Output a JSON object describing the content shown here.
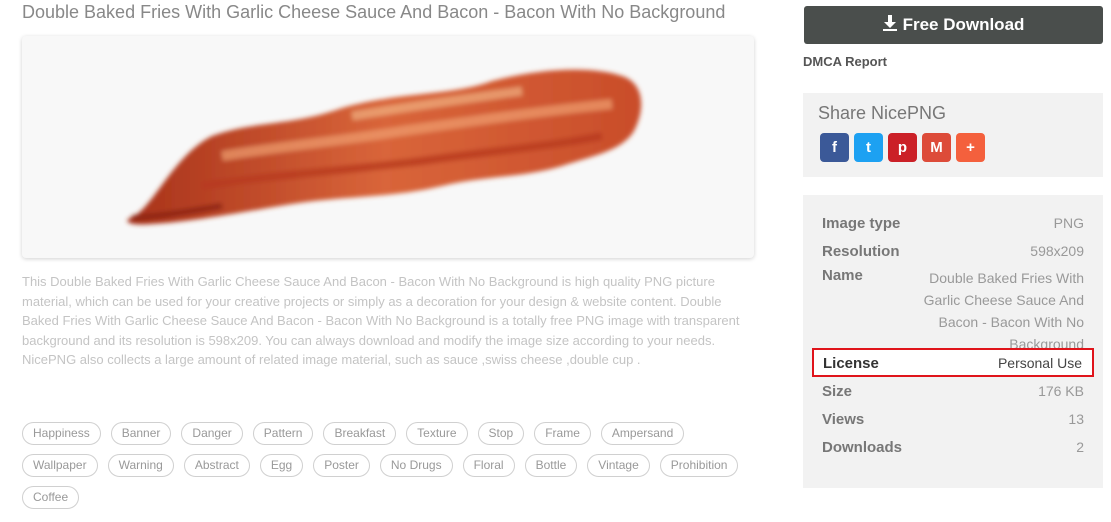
{
  "page": {
    "title": "Double Baked Fries With Garlic Cheese Sauce And Bacon - Bacon With No Background",
    "description": "This Double Baked Fries With Garlic Cheese Sauce And Bacon - Bacon With No Background is high quality PNG picture material, which can be used for your creative projects or simply as a decoration for your design & website content. Double Baked Fries With Garlic Cheese Sauce And Bacon - Bacon With No Background is a totally free PNG image with transparent background and its resolution is 598x209. You can always download and modify the image size according to your needs. NicePNG also collects a large amount of related image material, such as sauce ,swiss cheese ,double cup ."
  },
  "tags": [
    "Happiness",
    "Banner",
    "Danger",
    "Pattern",
    "Breakfast",
    "Texture",
    "Stop",
    "Frame",
    "Ampersand",
    "Wallpaper",
    "Warning",
    "Abstract",
    "Egg",
    "Poster",
    "No Drugs",
    "Floral",
    "Bottle",
    "Vintage",
    "Prohibition",
    "Coffee"
  ],
  "sidebar": {
    "download_label": "Free Download",
    "download_icon": "download-icon",
    "dmca_label": "DMCA Report",
    "share_title": "Share NicePNG",
    "share_buttons": [
      {
        "glyph": "f",
        "icon": "facebook-icon",
        "color": "#3b5998"
      },
      {
        "glyph": "t",
        "icon": "twitter-icon",
        "color": "#1da1f2"
      },
      {
        "glyph": "p",
        "icon": "pinterest-icon",
        "color": "#cb2027"
      },
      {
        "glyph": "M",
        "icon": "gmail-icon",
        "color": "#dd4b39"
      },
      {
        "glyph": "+",
        "icon": "more-share-icon",
        "color": "#f4603d"
      }
    ]
  },
  "info": {
    "image_type": {
      "label": "Image type",
      "value": "PNG"
    },
    "resolution": {
      "label": "Resolution",
      "value": "598x209"
    },
    "name": {
      "label": "Name",
      "value": "Double Baked Fries With Garlic Cheese Sauce And Bacon - Bacon With No Background"
    },
    "license": {
      "label": "License",
      "value": "Personal Use"
    },
    "size": {
      "label": "Size",
      "value": "176 KB"
    },
    "views": {
      "label": "Views",
      "value": "13"
    },
    "downloads": {
      "label": "Downloads",
      "value": "2"
    }
  },
  "colors": {
    "download_bg": "#4a4e4c",
    "highlight": "#e0141b"
  }
}
